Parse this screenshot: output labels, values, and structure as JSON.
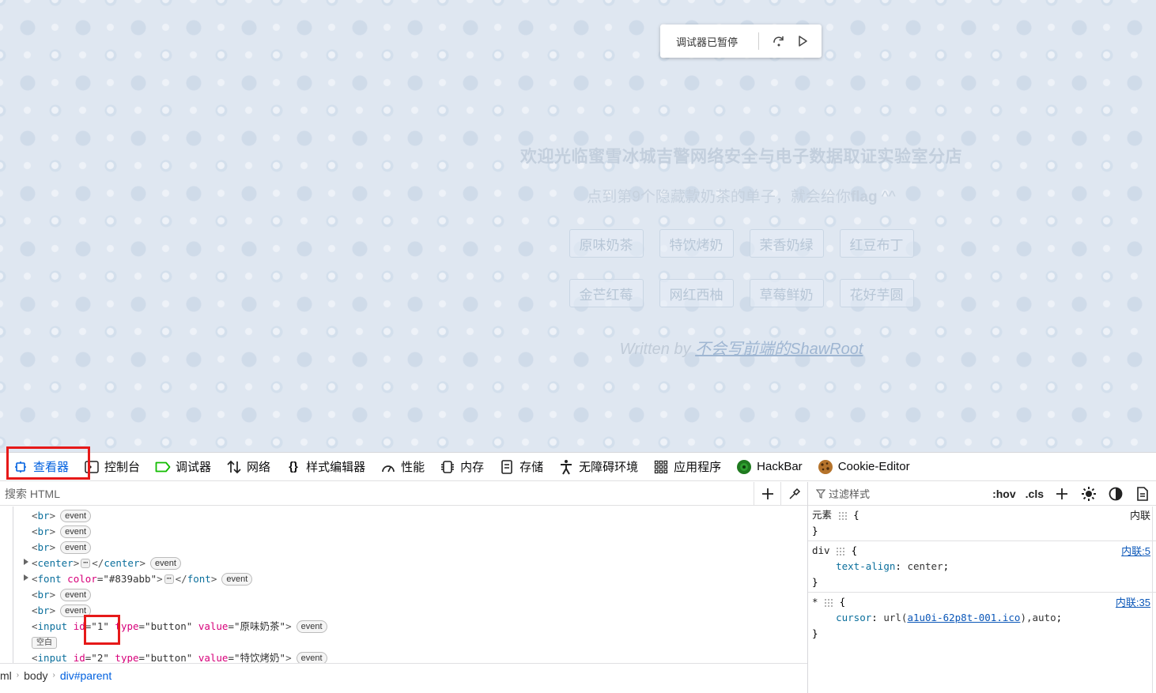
{
  "debugger_overlay": {
    "label": "调试器已暂停"
  },
  "site": {
    "title": "欢迎光临蜜雪冰城吉警网络安全与电子数据取证实验室分店",
    "subtitle_prefix": "点到第9个隐藏款奶茶的单子，就会给你",
    "subtitle_bold": "flag",
    "subtitle_suffix": " ^^",
    "buttons_row1": [
      "原味奶茶",
      "特饮烤奶",
      "茉香奶绿",
      "红豆布丁"
    ],
    "buttons_row2": [
      "金芒红莓",
      "网红西柚",
      "草莓鲜奶",
      "花好芋圆"
    ],
    "written_by": "Written by ",
    "author": "不会写前端的ShawRoot"
  },
  "devtools": {
    "tabs": [
      "查看器",
      "控制台",
      "调试器",
      "网络",
      "样式编辑器",
      "性能",
      "内存",
      "存储",
      "无障碍环境",
      "应用程序",
      "HackBar",
      "Cookie-Editor"
    ],
    "search_placeholder": "搜索 HTML",
    "markup": {
      "event_label": "event",
      "empty_label": "空白",
      "ellipsis": "⋯",
      "br_tag": "br",
      "center_tag": "center",
      "font_tag": "font",
      "font_attr": "color",
      "font_color_value": "#839abb",
      "input_tag": "input",
      "input1": {
        "id": "1",
        "type": "button",
        "value": "原味奶茶"
      },
      "input2": {
        "id": "2",
        "type": "button",
        "value": "特饮烤奶"
      }
    },
    "breadcrumbs": [
      "ml",
      "body",
      "div#parent"
    ],
    "rules": {
      "filter_placeholder": "过滤样式",
      "hov": ":hov",
      "cls": ".cls",
      "element_rule": {
        "selector": "元素",
        "source": "内联"
      },
      "div_rule": {
        "selector": "div",
        "source": "内联:5",
        "property": "text-align",
        "value": "center"
      },
      "star_rule": {
        "selector": "*",
        "source": "内联:35",
        "property": "cursor",
        "url_fn": "url(",
        "url": "a1u0i-62p8t-001.ico",
        "url_tail": "),auto"
      }
    }
  },
  "colors": {
    "highlight": "#e61919",
    "accent": "#0060df"
  }
}
